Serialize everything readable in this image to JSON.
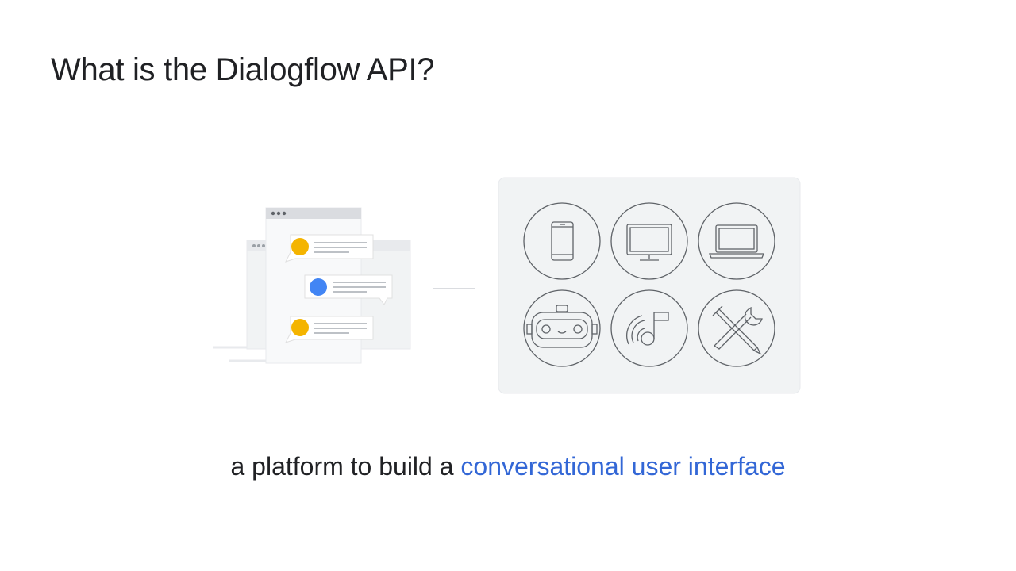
{
  "slide": {
    "title": "What is the Dialogflow API?",
    "subtitle_plain": "a platform to build a",
    "subtitle_highlight": "conversational user interface"
  },
  "colors": {
    "highlight": "#3367d6",
    "bubble_yellow": "#f4b400",
    "bubble_blue": "#4285f4",
    "panel_bg": "#f1f3f4",
    "icon_stroke": "#5f6368"
  },
  "icons": [
    "phone-icon",
    "monitor-icon",
    "laptop-icon",
    "robot-icon",
    "music-icon",
    "tools-icon"
  ]
}
